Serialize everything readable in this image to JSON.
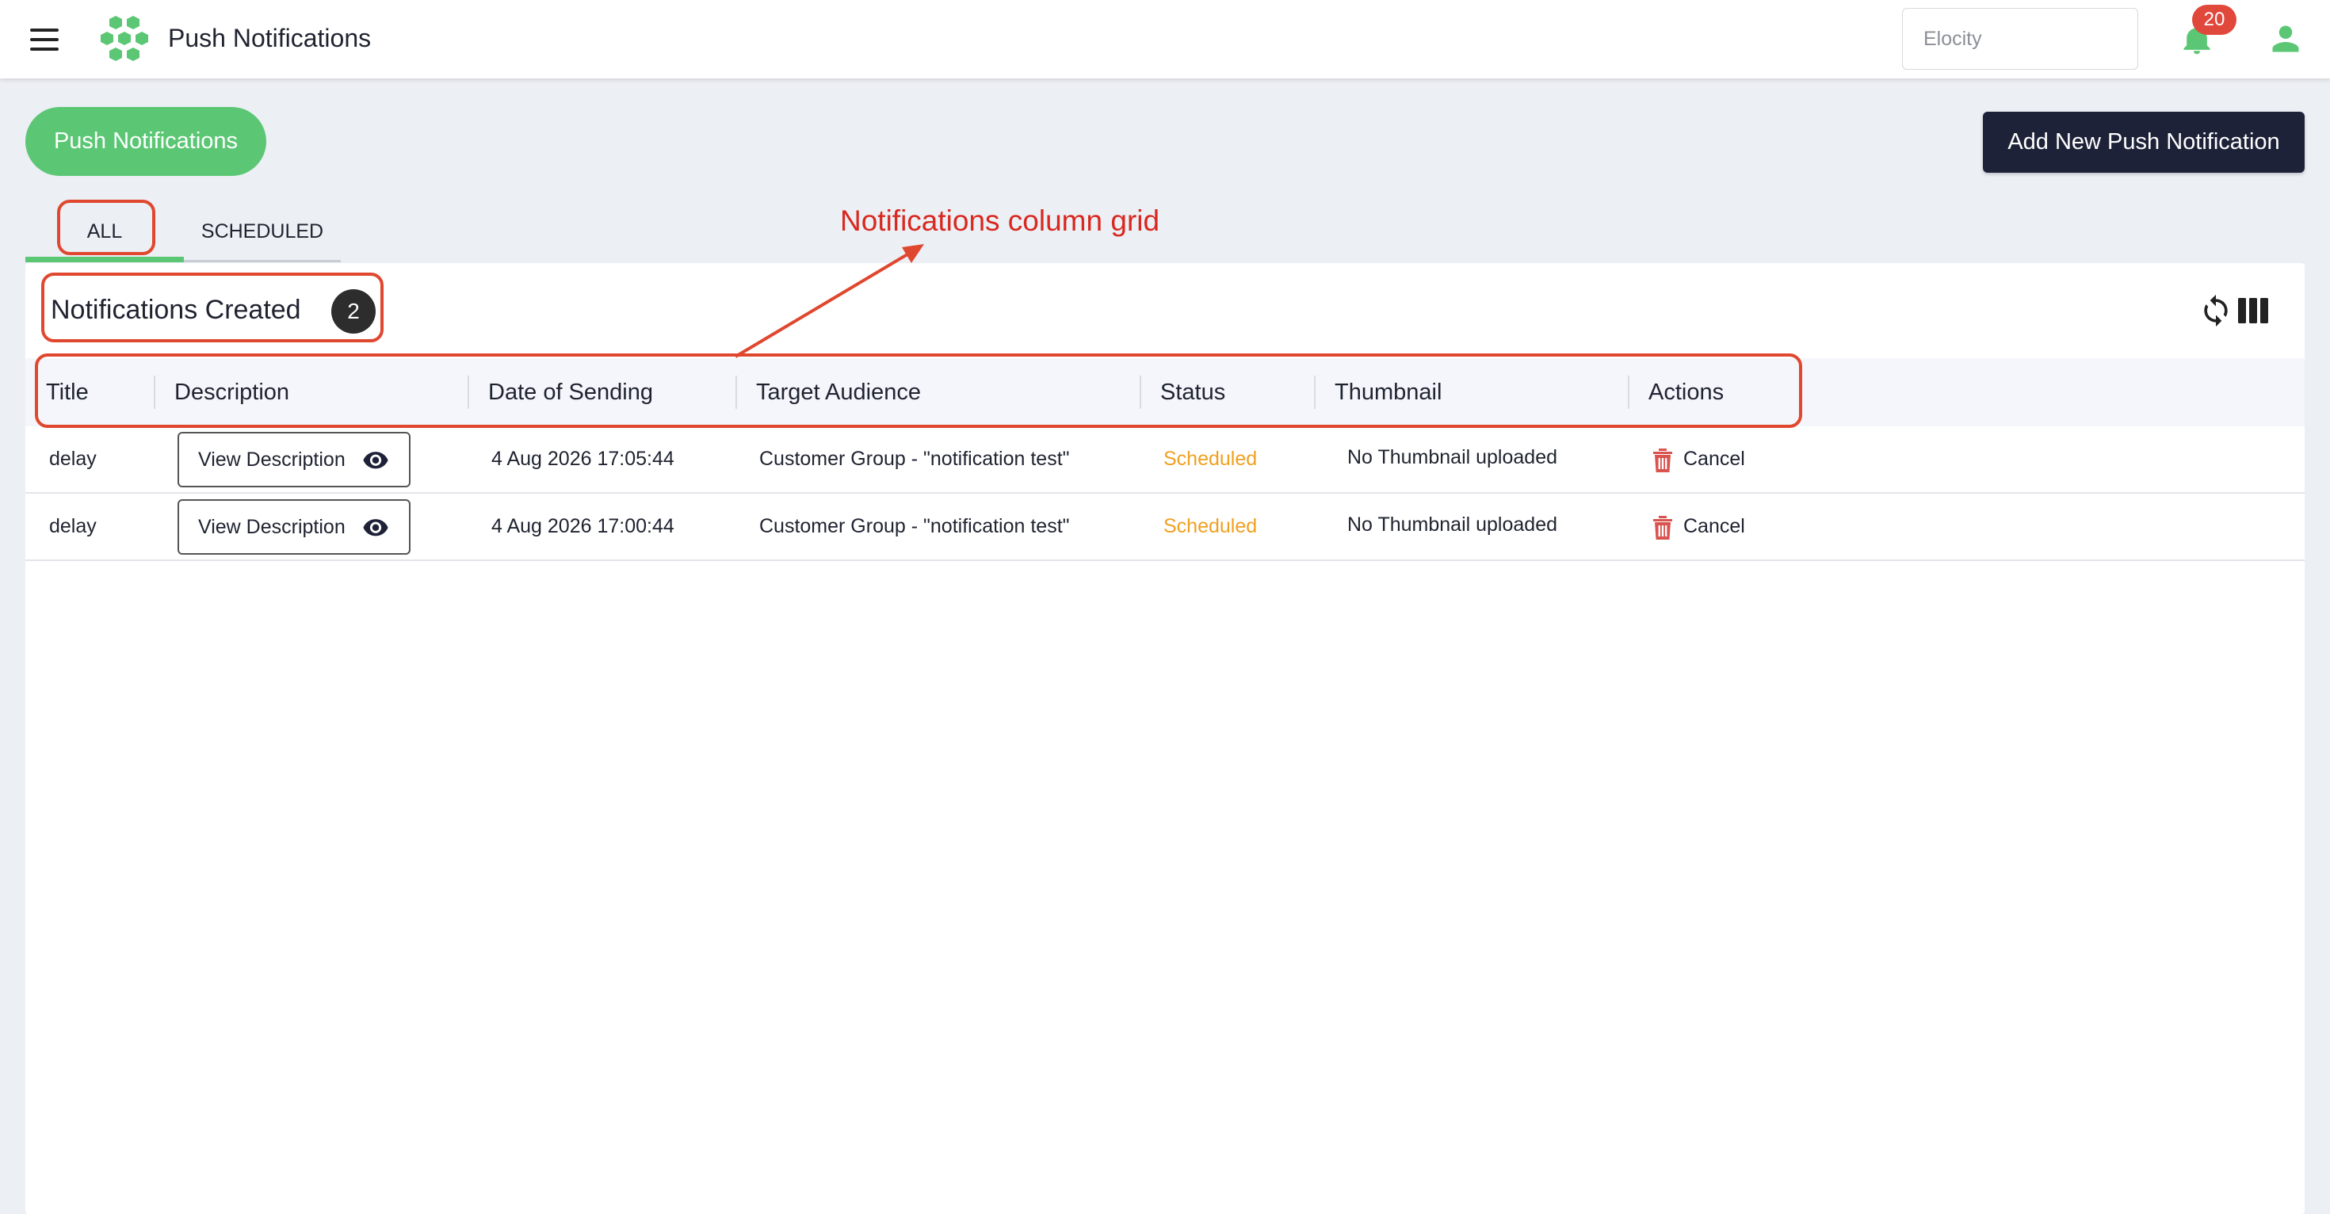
{
  "header": {
    "title": "Push Notifications",
    "store_select_value": "Elocity",
    "notification_count": "20"
  },
  "page": {
    "pill_label": "Push Notifications",
    "add_button_label": "Add New Push Notification"
  },
  "tabs": [
    {
      "label": "ALL",
      "active": true
    },
    {
      "label": "SCHEDULED",
      "active": false
    }
  ],
  "card": {
    "title": "Notifications Created",
    "count": "2"
  },
  "table": {
    "columns": [
      "Title",
      "Description",
      "Date of Sending",
      "Target Audience",
      "Status",
      "Thumbnail",
      "Actions"
    ],
    "rows": [
      {
        "title": "delay",
        "description_button": "View Description",
        "date": "4 Aug 2026 17:05:44",
        "audience": "Customer Group - \"notification test\"",
        "status": "Scheduled",
        "thumbnail": "No Thumbnail uploaded",
        "action": "Cancel"
      },
      {
        "title": "delay",
        "description_button": "View Description",
        "date": "4 Aug 2026 17:00:44",
        "audience": "Customer Group - \"notification test\"",
        "status": "Scheduled",
        "thumbnail": "No Thumbnail uploaded",
        "action": "Cancel"
      }
    ]
  },
  "annotation": {
    "label": "Notifications column grid"
  },
  "colors": {
    "brand_green": "#5bc774",
    "dark_button": "#1e2238",
    "status_scheduled": "#f0a020",
    "annotation_red": "#e0472f",
    "badge_red": "#e0483c"
  },
  "icons": [
    "menu-icon",
    "logo-hexagons",
    "bell-icon",
    "user-icon",
    "refresh-icon",
    "columns-icon",
    "eye-icon",
    "trash-icon"
  ]
}
